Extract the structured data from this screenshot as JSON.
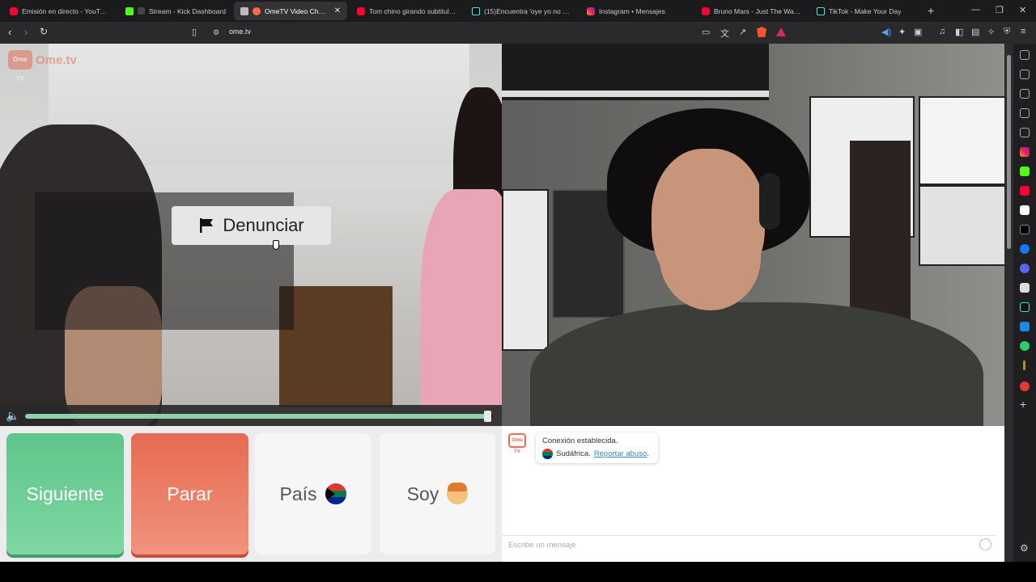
{
  "browser": {
    "tabs": [
      {
        "title": "Emisión en directo - YouTube S",
        "icon": "youtube-icon"
      },
      {
        "title": "Stream - Kick Dashboard",
        "icon": "kick-icon"
      },
      {
        "title": "OmeTV Video Chat — I",
        "icon": "ometv-icon",
        "active": true
      },
      {
        "title": "Tom chino girando subtitulado",
        "icon": "youtube-icon"
      },
      {
        "title": "(15)Encuentra 'oye yo no mue",
        "icon": "tiktok-icon"
      },
      {
        "title": "Instagram • Mensajes",
        "icon": "instagram-icon"
      },
      {
        "title": "Bruno Mars - Just The Way You",
        "icon": "youtube-icon"
      },
      {
        "title": "TikTok - Make Your Day",
        "icon": "tiktok-icon"
      }
    ],
    "url": "ome.tv"
  },
  "video": {
    "logo_badge": "Ome TV",
    "logo_text": "Ome.tv",
    "report_label": "Denunciar",
    "volume_level": 0.99
  },
  "controls": {
    "next_label": "Siguiente",
    "stop_label": "Parar",
    "country_label": "País",
    "gender_label": "Soy",
    "colors": {
      "next": "#5ec58b",
      "stop": "#e76a52"
    }
  },
  "chat": {
    "logo_badge": "Ome TV",
    "status": "Conexión establecida.",
    "country": "Sudáfrica.",
    "report_link": "Reportar abuso",
    "report_link_suffix": ".",
    "input_placeholder": "Escribe un mensaje"
  }
}
